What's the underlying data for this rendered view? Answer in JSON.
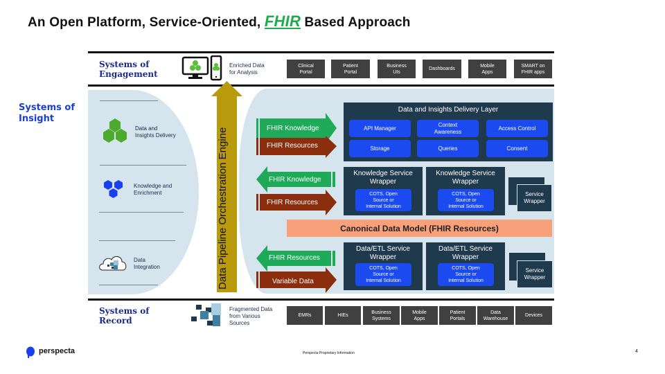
{
  "title": {
    "prefix": "An Open Platform, Service-Oriented,",
    "highlight": "FHIR",
    "suffix": "Based Approach",
    "highlight_color": "#1faa4c"
  },
  "engagement": {
    "label_line1": "Systems of",
    "label_line2": "Engagement",
    "enriched_line1": "Enriched Data",
    "enriched_line2": "for Analysis",
    "channels": [
      {
        "line1": "Clinical",
        "line2": "Portal"
      },
      {
        "line1": "Patient",
        "line2": "Portal"
      },
      {
        "line1": "Business",
        "line2": "UIs"
      },
      {
        "line1": "Dashboards",
        "line2": ""
      },
      {
        "line1": "Mobile",
        "line2": "Apps"
      },
      {
        "line1": "SMART on",
        "line2": "FHIR apps"
      }
    ]
  },
  "insight": {
    "label_line1": "Systems of",
    "label_line2": "Insight",
    "layers": [
      {
        "line1": "Data and",
        "line2": "Insights Delivery",
        "icon": "green-hexagon-cluster-icon"
      },
      {
        "line1": "Knowledge and",
        "line2": "Enrichment",
        "icon": "blue-hexagons-icon"
      },
      {
        "line1": "Data",
        "line2": "Integration",
        "icon": "cloud-data-icon"
      }
    ]
  },
  "engine": {
    "label": "Data Pipeline Orchestration Engine",
    "color": "#b89a0c"
  },
  "arrows": {
    "delivery_knowledge": "FHIR Knowledge",
    "delivery_resources": "FHIR Resources",
    "knowledge_knowledge": "FHIR Knowledge",
    "knowledge_resources": "FHIR Resources",
    "integration_resources": "FHIR Resources",
    "integration_variable": "Variable Data",
    "green": "#1faa5a",
    "brown": "#8a2e0e"
  },
  "delivery_layer": {
    "title": "Data and Insights Delivery Layer",
    "items": [
      {
        "line1": "API Manager",
        "line2": ""
      },
      {
        "line1": "Context",
        "line2": "Awareness"
      },
      {
        "line1": "Access Control",
        "line2": ""
      },
      {
        "line1": "Storage",
        "line2": ""
      },
      {
        "line1": "Queries",
        "line2": ""
      },
      {
        "line1": "Consent",
        "line2": ""
      }
    ]
  },
  "knowledge_wrappers": [
    {
      "title_line1": "Knowledge Service",
      "title_line2": "Wrapper",
      "inner_line1": "COTS, Open",
      "inner_line2": "Source or",
      "inner_line3": "Internal Solution"
    },
    {
      "title_line1": "Knowledge Service",
      "title_line2": "Wrapper",
      "inner_line1": "COTS, Open",
      "inner_line2": "Source or",
      "inner_line3": "Internal Solution"
    }
  ],
  "knowledge_stack": {
    "line1": "Service",
    "line2": "Wrapper"
  },
  "canonical": "Canonical Data Model (FHIR Resources)",
  "etl_wrappers": [
    {
      "title_line1": "Data/ETL Service",
      "title_line2": "Wrapper",
      "inner_line1": "COTS, Open",
      "inner_line2": "Source or",
      "inner_line3": "Internal Solution"
    },
    {
      "title_line1": "Data/ETL Service",
      "title_line2": "Wrapper",
      "inner_line1": "COTS, Open",
      "inner_line2": "Source or",
      "inner_line3": "Internal Solution"
    }
  ],
  "etl_stack": {
    "line1": "Service",
    "line2": "Wrapper"
  },
  "record": {
    "label_line1": "Systems of",
    "label_line2": "Record",
    "fragmented_line1": "Fragmented Data",
    "fragmented_line2": "from Various",
    "fragmented_line3": "Sources",
    "sources": [
      {
        "line1": "EMRs",
        "line2": ""
      },
      {
        "line1": "HIEs",
        "line2": ""
      },
      {
        "line1": "Business",
        "line2": "Systems"
      },
      {
        "line1": "Mobile",
        "line2": "Apps"
      },
      {
        "line1": "Patient",
        "line2": "Portals"
      },
      {
        "line1": "Data",
        "line2": "Warehouse"
      },
      {
        "line1": "Devices",
        "line2": ""
      }
    ]
  },
  "footer": {
    "brand": "perspecta",
    "notice": "Perspecta Proprietary Information",
    "page": "4"
  }
}
